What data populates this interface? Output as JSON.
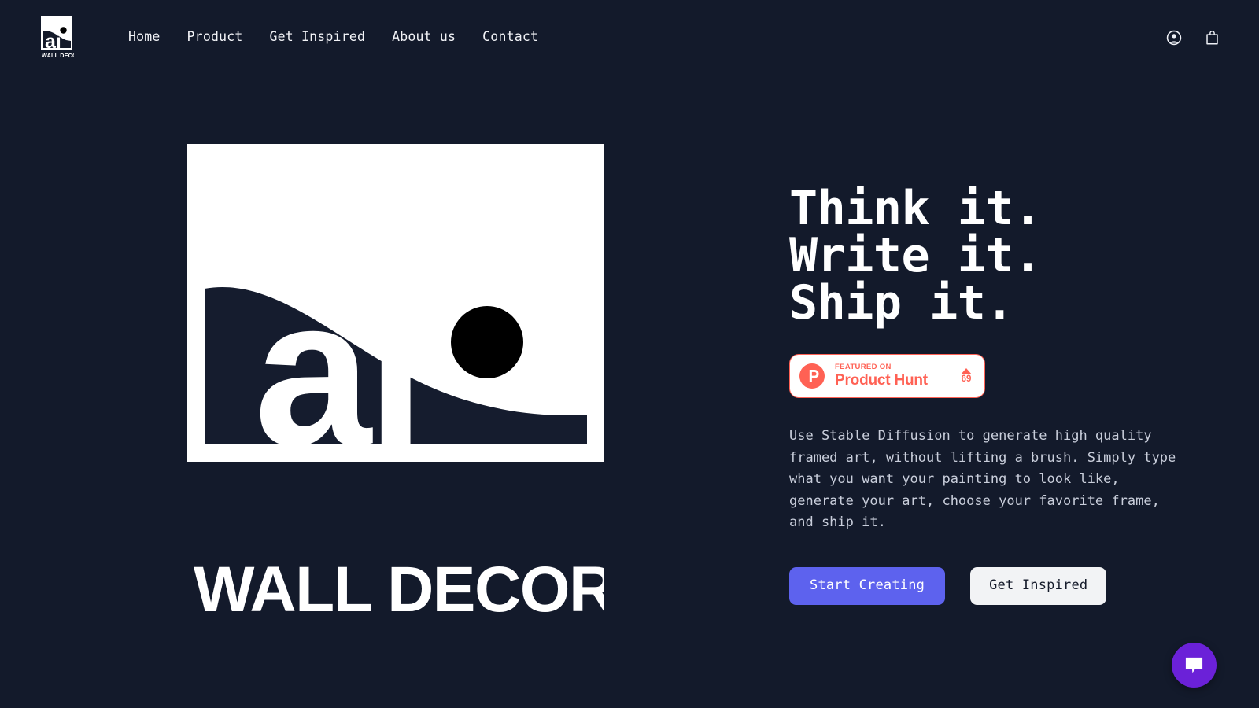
{
  "theme": {
    "background": "#131a2b",
    "accent_primary": "#5d62ee",
    "accent_producthunt": "#ff6154",
    "chat_purple": "#6b21d8",
    "text_primary": "#ffffff",
    "text_muted": "#c9cedb"
  },
  "header": {
    "logo": {
      "name": "ai",
      "tagline": "WALL DECOR",
      "alt": "ai Wall Decor logo"
    },
    "nav": [
      {
        "label": "Home",
        "name": "nav-home"
      },
      {
        "label": "Product",
        "name": "nav-product"
      },
      {
        "label": "Get Inspired",
        "name": "nav-get-inspired"
      },
      {
        "label": "About us",
        "name": "nav-about-us"
      },
      {
        "label": "Contact",
        "name": "nav-contact"
      }
    ],
    "actions": {
      "account_icon": "user-circle-icon",
      "cart_icon": "shopping-bag-icon"
    }
  },
  "hero": {
    "poster": {
      "brand": "ai",
      "tagline": "WALL DECOR",
      "alt": "Framed ai Wall Decor poster art"
    },
    "headline": "Think it.\nWrite it.\nShip it.",
    "product_hunt": {
      "featured_label": "FEATURED ON",
      "site_name": "Product Hunt",
      "upvotes": "69",
      "logo_icon": "product-hunt-p-icon",
      "caret_icon": "caret-up-icon"
    },
    "description": "Use Stable Diffusion to generate high quality\nframed art, without lifting a brush. Simply type\nwhat you want your painting to look like,\ngenerate your art, choose your favorite frame,\nand ship it.",
    "cta": {
      "primary_label": "Start Creating",
      "secondary_label": "Get Inspired"
    }
  },
  "chat": {
    "launcher_icon": "chat-bubble-icon",
    "launcher_label": "Open chat"
  }
}
